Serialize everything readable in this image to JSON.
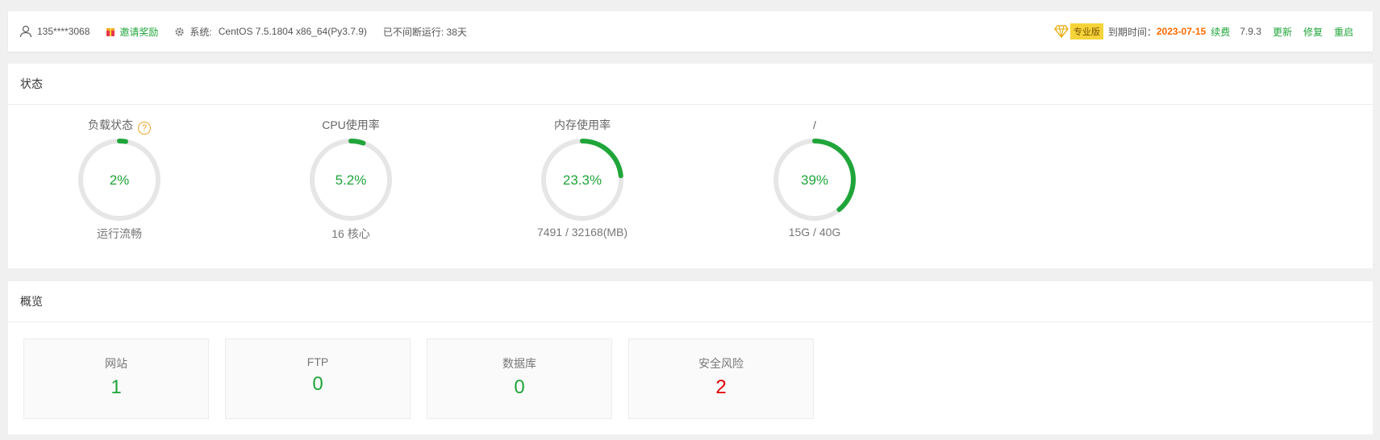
{
  "topbar": {
    "user": "135****3068",
    "invite": "邀请奖励",
    "system_label": "系统:",
    "system_value": "CentOS 7.5.1804 x86_64(Py3.7.9)",
    "uptime": "已不间断运行: 38天",
    "pro_badge": "专业版",
    "expire_label": "到期时间：",
    "expire_date": "2023-07-15",
    "renew": "续费",
    "version": "7.9.3",
    "update": "更新",
    "repair": "修复",
    "restart": "重启"
  },
  "status": {
    "title": "状态",
    "gauges": [
      {
        "title": "负载状态",
        "value": "2%",
        "percent": 2,
        "sub": "运行流畅"
      },
      {
        "title": "CPU使用率",
        "value": "5.2%",
        "percent": 5.2,
        "sub": "16 核心"
      },
      {
        "title": "内存使用率",
        "value": "23.3%",
        "percent": 23.3,
        "sub": "7491 / 32168(MB)"
      },
      {
        "title": "/",
        "value": "39%",
        "percent": 39,
        "sub": "15G / 40G"
      }
    ]
  },
  "overview": {
    "title": "概览",
    "cards": [
      {
        "label": "网站",
        "value": "1"
      },
      {
        "label": "FTP",
        "value": "0"
      },
      {
        "label": "数据库",
        "value": "0"
      },
      {
        "label": "安全风险",
        "value": "2"
      }
    ]
  },
  "colors": {
    "accent": "#20a53a",
    "danger": "#e10000",
    "expire": "#ff6a00",
    "track": "#e6e6e6"
  }
}
